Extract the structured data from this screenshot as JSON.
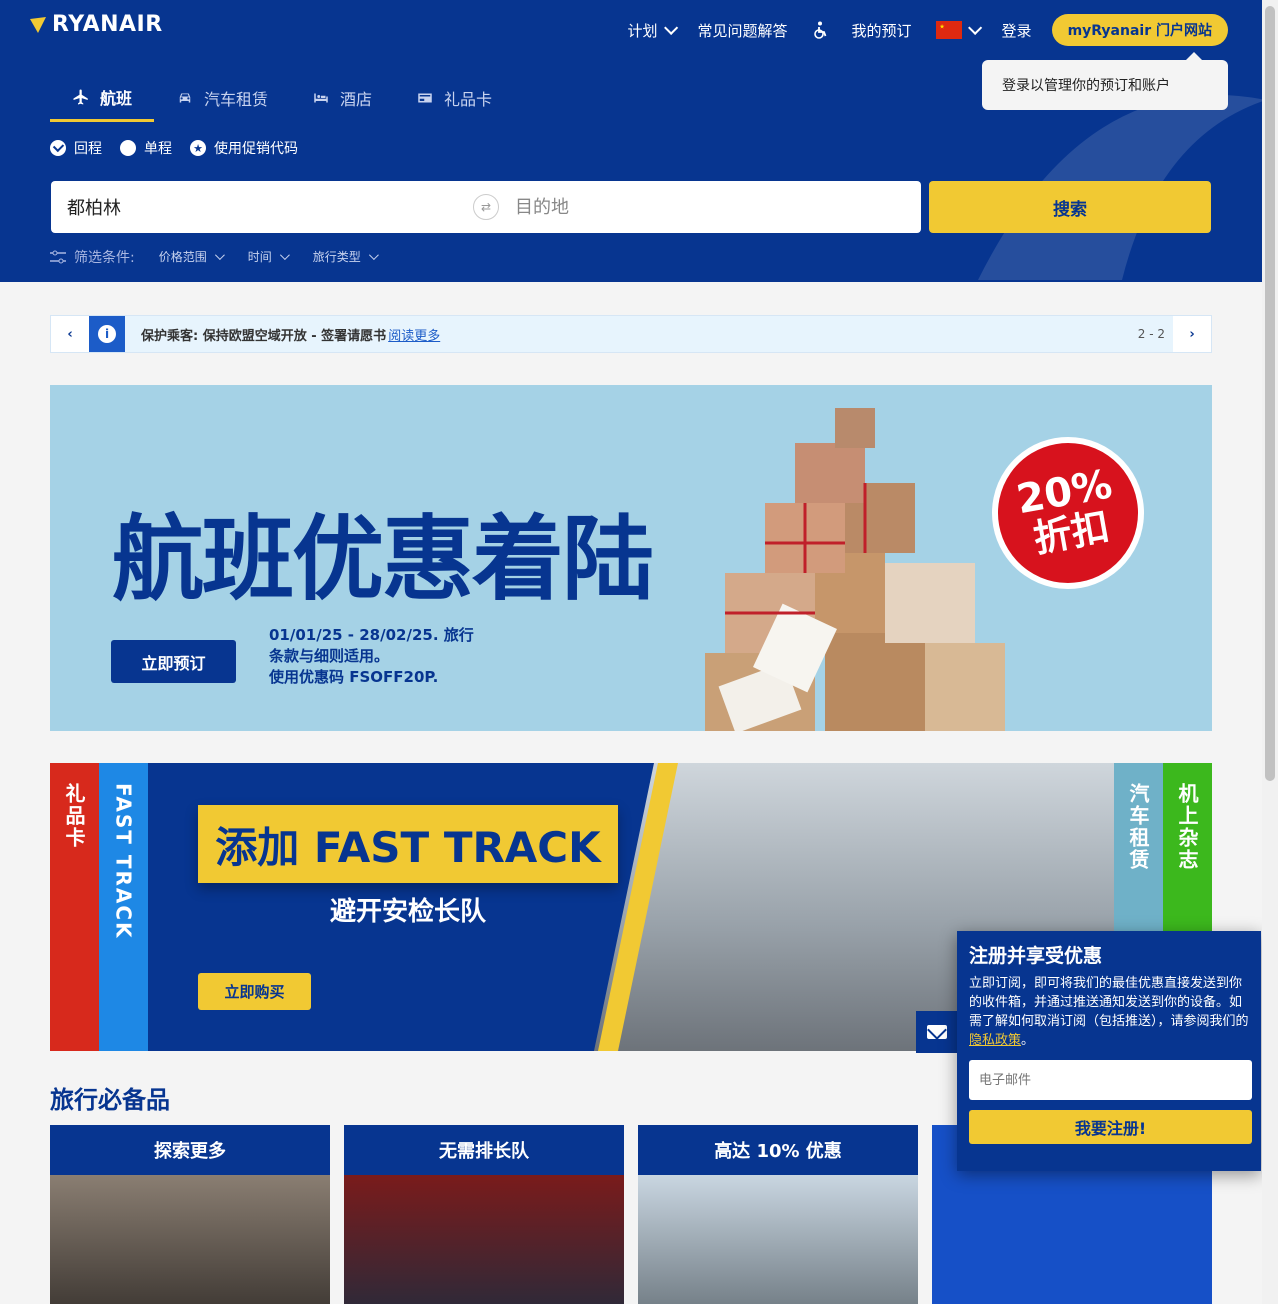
{
  "header": {
    "logo_text": "RYANAIR",
    "nav": {
      "plan": "计划",
      "faq": "常见问题解答",
      "bookings": "我的预订",
      "login": "登录",
      "my_ryanair": "myRyanair 门户网站"
    },
    "tooltip": "登录以管理你的预订和账户"
  },
  "tabs": [
    {
      "label": "航班",
      "icon": "plane-icon",
      "active": true
    },
    {
      "label": "汽车租赁",
      "icon": "car-icon",
      "active": false
    },
    {
      "label": "酒店",
      "icon": "bed-icon",
      "active": false
    },
    {
      "label": "礼品卡",
      "icon": "card-icon",
      "active": false
    }
  ],
  "trip_options": {
    "return": "回程",
    "one_way": "单程",
    "promo": "使用促销代码"
  },
  "search": {
    "origin_value": "都柏林",
    "destination_placeholder": "目的地",
    "button": "搜索"
  },
  "filters": {
    "label": "筛选条件:",
    "price": "价格范围",
    "time": "时间",
    "trip_type": "旅行类型"
  },
  "notice": {
    "message": "保护乘客: 保持欧盟空域开放 - 签署请愿书",
    "read_more": "阅读更多",
    "pager": "2 - 2"
  },
  "promo": {
    "title": "航班优惠着陆",
    "button": "立即预订",
    "terms_line1": "01/01/25 - 28/02/25. 旅行",
    "terms_line2": "条款与细则适用。",
    "terms_line3": "使用优惠码 FSOFF20P.",
    "badge_pct": "20%",
    "badge_off": "折扣"
  },
  "accordion": {
    "gift_card": "礼品卡",
    "fast_track": "FAST TRACK",
    "main_title": "添加 FAST TRACK",
    "main_sub": "避开安检长队",
    "main_btn": "立即购买",
    "car_hire": "汽车租赁",
    "magazine": "机上杂志"
  },
  "essentials": {
    "title": "旅行必备品",
    "cards": [
      {
        "title": "探索更多"
      },
      {
        "title": "无需排长队"
      },
      {
        "title": "高达 10% 优惠"
      }
    ]
  },
  "signup": {
    "title": "注册并享受优惠",
    "body": "立即订阅，即可将我们的最佳优惠直接发送到你的收件箱，并通过推送通知发送到你的设备。如需了解如何取消订阅（包括推送），请参阅我们的",
    "privacy": "隐私政策",
    "period": "。",
    "email_placeholder": "电子邮件",
    "button": "我要注册!"
  },
  "colors": {
    "brand_blue": "#073590",
    "brand_yellow": "#f1c933",
    "gift_red": "#d7291c",
    "fast_track_blue": "#1e88e5",
    "car_teal": "#6fb1c8",
    "magazine_green": "#3cb81d"
  }
}
